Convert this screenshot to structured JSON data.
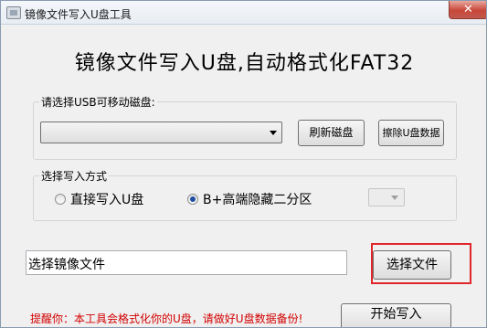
{
  "window": {
    "title": "镜像文件写入U盘工具",
    "close_label": "✕"
  },
  "headline": "镜像文件写入U盘,自动格式化FAT32",
  "usb_group": {
    "label": "请选择USB可移动磁盘:",
    "selected_disk": "",
    "refresh_label": "刷新磁盘",
    "erase_label": "擦除U盘数据"
  },
  "mode_group": {
    "label": "选择写入方式",
    "option_direct": "直接写入U盘",
    "option_hidden": "B+高端隐藏二分区",
    "selected": "option_hidden"
  },
  "file": {
    "path_value": "选择镜像文件",
    "choose_label": "选择文件"
  },
  "start_label": "开始写入",
  "warning": "提醒你：本工具会格式化你的U盘，请做好U盘数据备份!",
  "colors": {
    "warning": "#d20000",
    "highlight": "#e0262a",
    "radio_dot": "#1f4ea1"
  }
}
